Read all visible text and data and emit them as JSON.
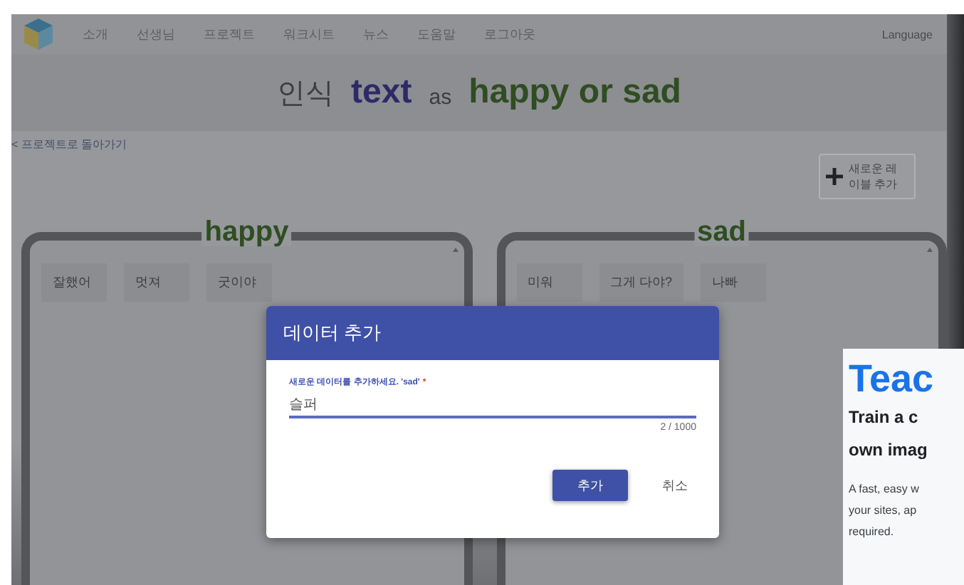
{
  "nav": {
    "items": [
      "소개",
      "선생님",
      "프로젝트",
      "워크시트",
      "뉴스",
      "도움말",
      "로그아웃"
    ],
    "language": "Language"
  },
  "heading": {
    "prefix": "인식",
    "type": "text",
    "middle": "as",
    "labels": "happy or sad"
  },
  "back_link": "< 프로젝트로 돌아가기",
  "add_label_button": "새로운 레이블 추가",
  "buckets": [
    {
      "name": "happy",
      "items": [
        "잘했어",
        "멋져",
        "굿이야"
      ]
    },
    {
      "name": "sad",
      "items": [
        "미워",
        "그게 다야?",
        "나빠"
      ]
    }
  ],
  "dialog": {
    "title": "데이터 추가",
    "field_label": "새로운 데이터를 추가하세요. 'sad'",
    "required_mark": "*",
    "value": "슬퍼",
    "counter": "2 / 1000",
    "buttons": [
      {
        "label": "추가",
        "kind": "primary"
      },
      {
        "label": "취소",
        "kind": "text"
      }
    ]
  },
  "side_window": {
    "heading": "Teac",
    "subheading_lines": [
      "Train a c",
      "own imag"
    ],
    "body_lines": [
      "A fast, easy w",
      "your sites, ap",
      "required."
    ]
  }
}
